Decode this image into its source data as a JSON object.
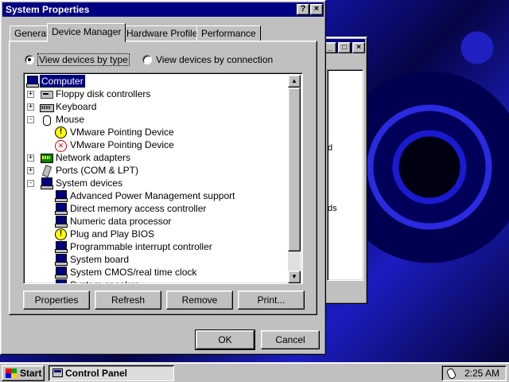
{
  "dialog": {
    "title": "System Properties",
    "help_label": "?",
    "close_label": "×",
    "tabs": [
      {
        "label": "General"
      },
      {
        "label": "Device Manager"
      },
      {
        "label": "Hardware Profiles"
      },
      {
        "label": "Performance"
      }
    ],
    "active_tab": "Device Manager",
    "view_options": [
      {
        "label": "View devices by type",
        "selected": true
      },
      {
        "label": "View devices by connection",
        "selected": false
      }
    ],
    "tree": [
      {
        "label": "Computer",
        "level": 0,
        "icon": "computer-icon",
        "selected": true
      },
      {
        "label": "Floppy disk controllers",
        "level": 1,
        "icon": "floppy-controller-icon",
        "expander": "+"
      },
      {
        "label": "Keyboard",
        "level": 1,
        "icon": "keyboard-icon",
        "expander": "+"
      },
      {
        "label": "Mouse",
        "level": 1,
        "icon": "mouse-icon",
        "expander": "-"
      },
      {
        "label": "VMware Pointing Device",
        "level": 2,
        "icon": "warning-device-icon"
      },
      {
        "label": "VMware Pointing Device",
        "level": 2,
        "icon": "disabled-device-icon"
      },
      {
        "label": "Network adapters",
        "level": 1,
        "icon": "network-adapter-icon",
        "expander": "+"
      },
      {
        "label": "Ports (COM & LPT)",
        "level": 1,
        "icon": "port-icon",
        "expander": "+"
      },
      {
        "label": "System devices",
        "level": 1,
        "icon": "system-devices-icon",
        "expander": "-"
      },
      {
        "label": "Advanced Power Management support",
        "level": 2,
        "icon": "system-device-icon"
      },
      {
        "label": "Direct memory access controller",
        "level": 2,
        "icon": "system-device-icon"
      },
      {
        "label": "Numeric data processor",
        "level": 2,
        "icon": "system-device-icon"
      },
      {
        "label": "Plug and Play BIOS",
        "level": 2,
        "icon": "warning-device-icon"
      },
      {
        "label": "Programmable interrupt controller",
        "level": 2,
        "icon": "system-device-icon"
      },
      {
        "label": "System board",
        "level": 2,
        "icon": "system-device-icon"
      },
      {
        "label": "System CMOS/real time clock",
        "level": 2,
        "icon": "system-device-icon"
      },
      {
        "label": "System speaker",
        "level": 2,
        "icon": "system-device-icon"
      }
    ],
    "action_buttons": {
      "properties": "Properties",
      "refresh": "Refresh",
      "remove": "Remove",
      "print": "Print..."
    },
    "ok_label": "OK",
    "cancel_label": "Cancel"
  },
  "background_window": {
    "text_fragments": [
      "d",
      "ds"
    ]
  },
  "taskbar": {
    "start_label": "Start",
    "task_label": "Control Panel",
    "clock": "2:25 AM"
  },
  "colors": {
    "title_bar": "#000080",
    "face": "#c0c0c0",
    "selection": "#000080",
    "desktop": "#0a0a6e"
  }
}
